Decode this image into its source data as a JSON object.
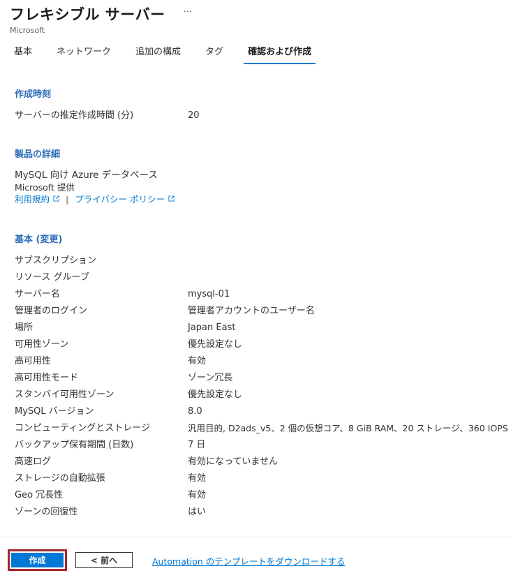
{
  "header": {
    "title": "フレキシブル サーバー",
    "more": "···",
    "publisher": "Microsoft"
  },
  "tabs": [
    {
      "label": "基本"
    },
    {
      "label": "ネットワーク"
    },
    {
      "label": "追加の構成"
    },
    {
      "label": "タグ"
    },
    {
      "label": "確認および作成",
      "active": true
    }
  ],
  "creation_time": {
    "title": "作成時刻",
    "label": "サーバーの推定作成時間 (分)",
    "value": "20"
  },
  "product": {
    "title": "製品の詳細",
    "name": "MySQL 向け Azure データベース",
    "provider": "Microsoft 提供",
    "terms_link": "利用規約",
    "separator": "|",
    "privacy_link": "プライバシー ポリシー"
  },
  "basics": {
    "title": "基本 (変更)",
    "rows": [
      {
        "label": "サブスクリプション",
        "value": ""
      },
      {
        "label": "リソース グループ",
        "value": ""
      },
      {
        "label": "サーバー名",
        "value": "mysql-01"
      },
      {
        "label": "管理者のログイン",
        "value": "管理者アカウントのユーザー名"
      },
      {
        "label": "場所",
        "value": "Japan East"
      },
      {
        "label": "可用性ゾーン",
        "value": "優先設定なし"
      },
      {
        "label": "高可用性",
        "value": "有効"
      },
      {
        "label": "高可用性モード",
        "value": "ゾーン冗長"
      },
      {
        "label": "スタンバイ可用性ゾーン",
        "value": "優先設定なし"
      },
      {
        "label": "MySQL バージョン",
        "value": "8.0"
      },
      {
        "label": "コンピューティングとストレージ",
        "value": "汎用目的, D2ads_v5、2 個の仮想コア、8 GiB RAM、20 ストレージ、360 IOPS"
      },
      {
        "label": "バックアップ保有期間 (日数)",
        "value": "7 日"
      },
      {
        "label": "高速ログ",
        "value": "有効になっていません"
      },
      {
        "label": "ストレージの自動拡張",
        "value": "有効"
      },
      {
        "label": "Geo 冗長性",
        "value": "有効"
      },
      {
        "label": "ゾーンの回復性",
        "value": "はい"
      }
    ]
  },
  "footer": {
    "create_label": "作成",
    "prev_label": "< 前へ",
    "download_link": "Automation のテンプレートをダウンロードする"
  },
  "colors": {
    "accent": "#0078d4",
    "section_title": "#2b6cb7",
    "highlight_border": "#a4262c"
  }
}
